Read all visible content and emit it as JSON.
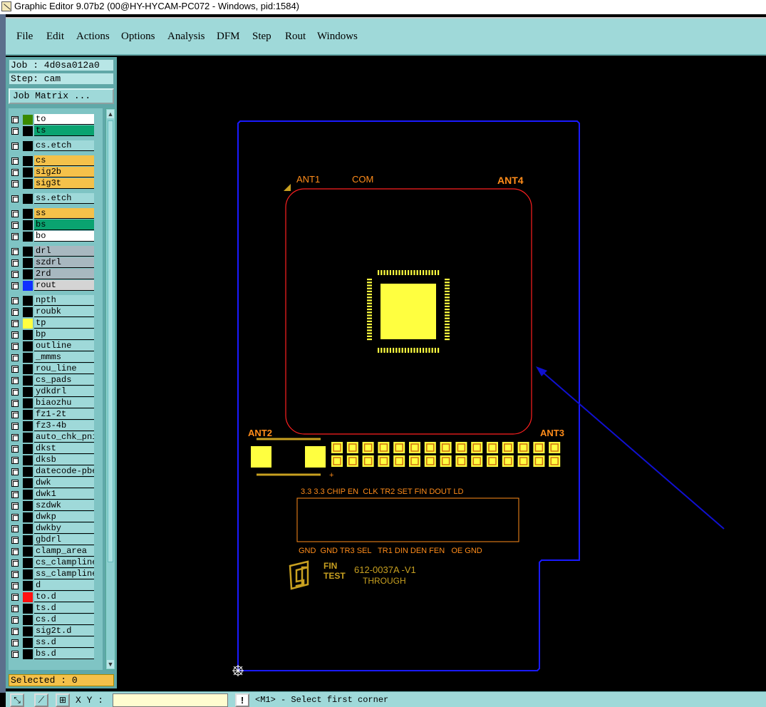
{
  "window": {
    "title": "Graphic Editor 9.07b2 (00@HY-HYCAM-PC072 - Windows, pid:1584)"
  },
  "menu": [
    {
      "label": "File"
    },
    {
      "label": "Edit"
    },
    {
      "label": "Actions"
    },
    {
      "label": "Options"
    },
    {
      "label": "Analysis"
    },
    {
      "label": "DFM"
    },
    {
      "label": "Step"
    },
    {
      "label": "Rout"
    },
    {
      "label": "Windows"
    }
  ],
  "job": {
    "job_label": "Job : 4d0sa012a0",
    "step_label": "Step: cam",
    "matrix_button": "Job Matrix ..."
  },
  "layers": [
    {
      "name": "to",
      "color": "#ffffff",
      "swatch": "#3a8a00"
    },
    {
      "name": "ts",
      "color": "#0aa370",
      "swatch": "#000000"
    },
    {
      "name": "cs.etch",
      "color": "#9fd9d9",
      "swatch": "#000000"
    },
    {
      "name": "cs",
      "color": "#f4c14a",
      "swatch": "#000000"
    },
    {
      "name": "sig2b",
      "color": "#f4c14a",
      "swatch": "#000000"
    },
    {
      "name": "sig3t",
      "color": "#f4c14a",
      "swatch": "#000000"
    },
    {
      "name": "ss.etch",
      "color": "#9fd9d9",
      "swatch": "#000000"
    },
    {
      "name": "ss",
      "color": "#f4c14a",
      "swatch": "#000000"
    },
    {
      "name": "bs",
      "color": "#0aa370",
      "swatch": "#000000"
    },
    {
      "name": "bo",
      "color": "#ffffff",
      "swatch": "#000000"
    },
    {
      "name": "drl",
      "color": "#a8b8c0",
      "swatch": "#000000"
    },
    {
      "name": "szdrl",
      "color": "#a8b8c0",
      "swatch": "#000000"
    },
    {
      "name": "2rd",
      "color": "#a8b8c0",
      "swatch": "#000000"
    },
    {
      "name": "rout",
      "color": "#d4d4d4",
      "swatch": "#1030ff"
    },
    {
      "name": "npth",
      "color": "#9fd9d9",
      "swatch": "#000000"
    },
    {
      "name": "roubk",
      "color": "#9fd9d9",
      "swatch": "#000000"
    },
    {
      "name": "tp",
      "color": "#9fd9d9",
      "swatch": "#ffff40"
    },
    {
      "name": "bp",
      "color": "#9fd9d9",
      "swatch": "#000000"
    },
    {
      "name": "outline",
      "color": "#9fd9d9",
      "swatch": "#000000"
    },
    {
      "name": "_mmms",
      "color": "#9fd9d9",
      "swatch": "#000000"
    },
    {
      "name": "rou_line",
      "color": "#9fd9d9",
      "swatch": "#000000"
    },
    {
      "name": "cs_pads",
      "color": "#9fd9d9",
      "swatch": "#000000"
    },
    {
      "name": "ydkdrl",
      "color": "#9fd9d9",
      "swatch": "#000000"
    },
    {
      "name": "biaozhu",
      "color": "#9fd9d9",
      "swatch": "#000000"
    },
    {
      "name": "fz1-2t",
      "color": "#9fd9d9",
      "swatch": "#000000"
    },
    {
      "name": "fz3-4b",
      "color": "#9fd9d9",
      "swatch": "#000000"
    },
    {
      "name": "auto_chk_pni",
      "color": "#9fd9d9",
      "swatch": "#000000"
    },
    {
      "name": "dkst",
      "color": "#9fd9d9",
      "swatch": "#000000"
    },
    {
      "name": "dksb",
      "color": "#9fd9d9",
      "swatch": "#000000"
    },
    {
      "name": "datecode-pbe",
      "color": "#9fd9d9",
      "swatch": "#000000"
    },
    {
      "name": "dwk",
      "color": "#9fd9d9",
      "swatch": "#000000"
    },
    {
      "name": "dwk1",
      "color": "#9fd9d9",
      "swatch": "#000000"
    },
    {
      "name": "szdwk",
      "color": "#9fd9d9",
      "swatch": "#000000"
    },
    {
      "name": "dwkp",
      "color": "#9fd9d9",
      "swatch": "#000000"
    },
    {
      "name": "dwkby",
      "color": "#9fd9d9",
      "swatch": "#000000"
    },
    {
      "name": "gbdrl",
      "color": "#9fd9d9",
      "swatch": "#000000"
    },
    {
      "name": "clamp_area",
      "color": "#9fd9d9",
      "swatch": "#000000"
    },
    {
      "name": "cs_clampline",
      "color": "#9fd9d9",
      "swatch": "#000000"
    },
    {
      "name": "ss_clampline",
      "color": "#9fd9d9",
      "swatch": "#000000"
    },
    {
      "name": "d",
      "color": "#9fd9d9",
      "swatch": "#000000"
    },
    {
      "name": "to.d",
      "color": "#9fd9d9",
      "swatch": "#ff1010"
    },
    {
      "name": "ts.d",
      "color": "#9fd9d9",
      "swatch": "#000000"
    },
    {
      "name": "cs.d",
      "color": "#9fd9d9",
      "swatch": "#000000"
    },
    {
      "name": "sig2t.d",
      "color": "#9fd9d9",
      "swatch": "#000000"
    },
    {
      "name": "ss.d",
      "color": "#9fd9d9",
      "swatch": "#000000"
    },
    {
      "name": "bs.d",
      "color": "#9fd9d9",
      "swatch": "#000000"
    }
  ],
  "selected": {
    "label": "Selected : 0"
  },
  "status": {
    "xy_label": "X Y :",
    "xy_value": "",
    "exclaim": "!",
    "prompt": "<M1> - Select first corner"
  },
  "board": {
    "labels": {
      "ant1": "ANT1",
      "com": "COM",
      "ant4": "ANT4",
      "ant2": "ANT2",
      "ant3": "ANT3",
      "plus": "+",
      "top_pins": "3.3 3.3 CHIP EN  CLK TR2 SET FIN DOUT LD",
      "bottom_pins": "GND  GND TR3 SEL   TR1 DIN DEN FEN   OE GND",
      "logo": "FIN TEST",
      "part": "612-0037A -V1",
      "through": "THROUGH"
    },
    "colors": {
      "outline": "#1a1aff",
      "antenna": "#ff2020",
      "pad": "#ffff40",
      "silk": "#ff8c1a",
      "logo": "#c8a020"
    }
  }
}
